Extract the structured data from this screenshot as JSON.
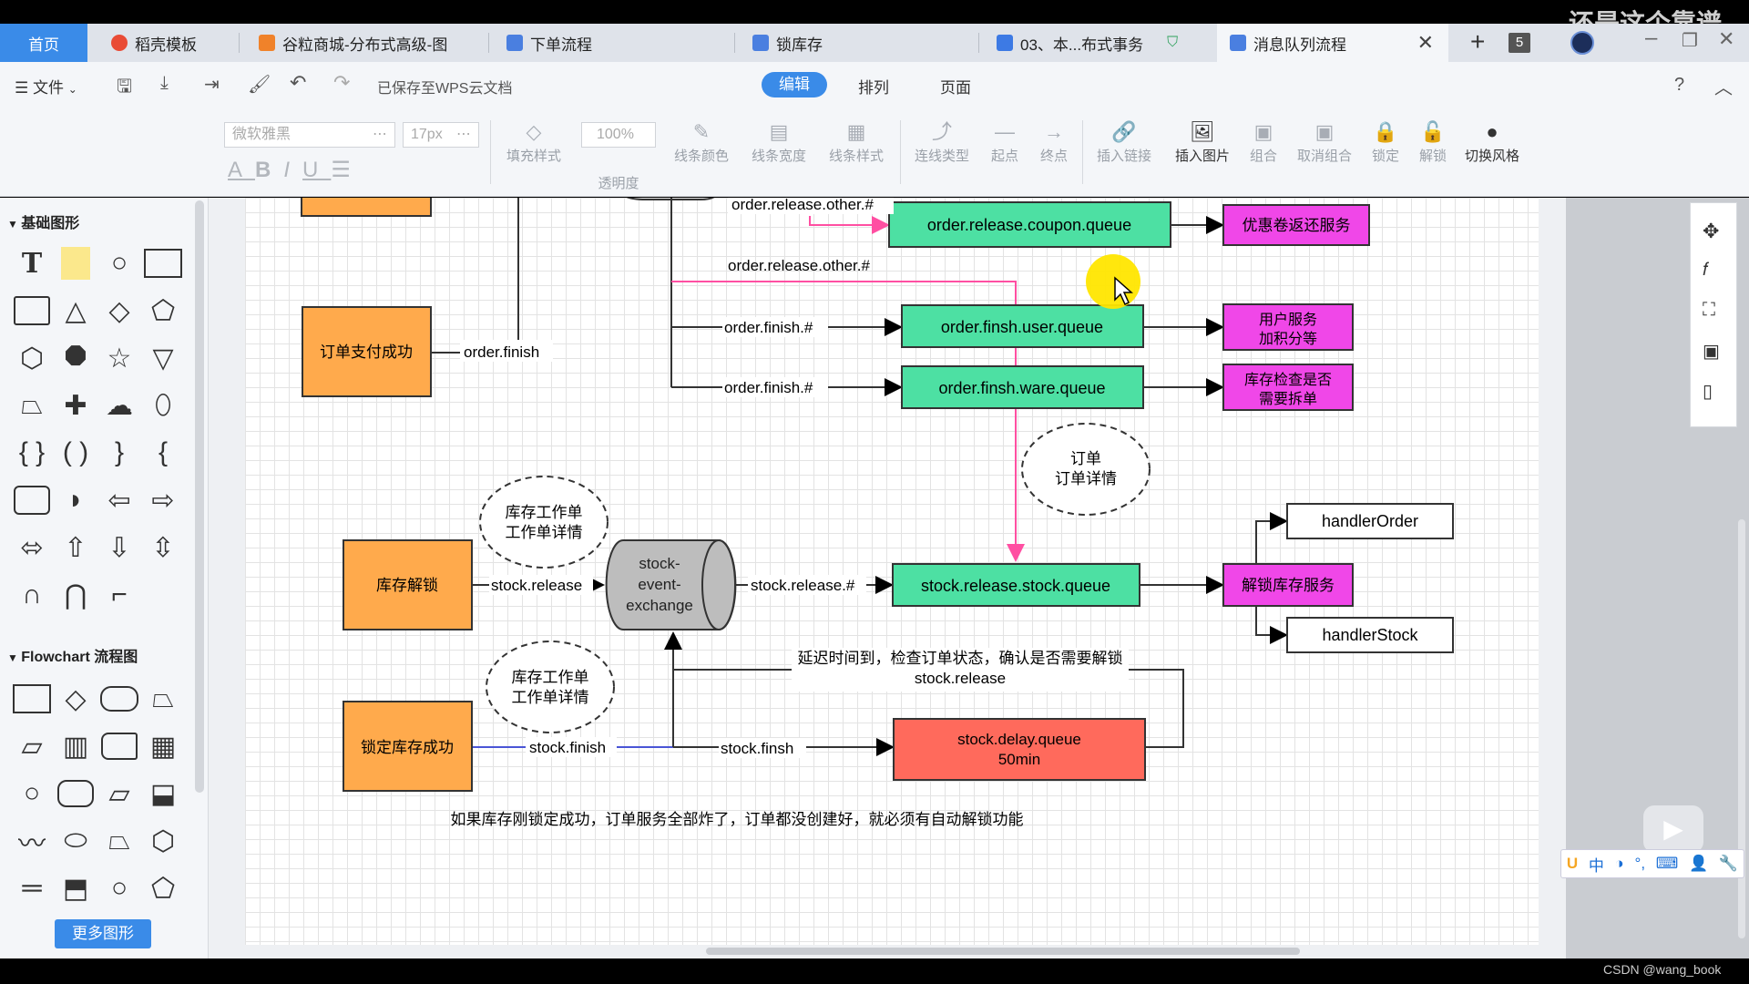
{
  "watermark": "还是这个靠谱",
  "credit": "CSDN @wang_book",
  "tabs": [
    {
      "label": "首页",
      "icon": "",
      "kind": "home"
    },
    {
      "label": "稻壳模板",
      "icon": "docer-icon",
      "color": "#e94b35"
    },
    {
      "label": "谷粒商城-分布式高级-图",
      "icon": "slides-icon",
      "color": "#f0822a"
    },
    {
      "label": "下单流程",
      "icon": "flowchart-icon",
      "color": "#4a7fe0"
    },
    {
      "label": "锁库存",
      "icon": "flowchart-icon",
      "color": "#4a7fe0"
    },
    {
      "label": "03、本...布式事务",
      "icon": "word-icon",
      "color": "#3d7ae4"
    },
    {
      "label": "消息队列流程",
      "icon": "flowchart-icon",
      "color": "#4a7fe0"
    }
  ],
  "tab_count": "5",
  "menu": {
    "file": "文件",
    "saved": "已保存至WPS云文档",
    "modes": [
      "编辑",
      "排列",
      "页面"
    ],
    "help": "?"
  },
  "ribbon": {
    "font": "微软雅黑",
    "size": "17px",
    "opacity": "100%",
    "buttons": [
      {
        "label": "填充样式",
        "glyph": "◇",
        "on": false
      },
      {
        "label": "透明度",
        "glyph": "",
        "on": false
      },
      {
        "label": "线条颜色",
        "glyph": "✎",
        "on": false
      },
      {
        "label": "线条宽度",
        "glyph": "▤",
        "on": false
      },
      {
        "label": "线条样式",
        "glyph": "▦",
        "on": false
      },
      {
        "label": "连线类型",
        "glyph": "⤴",
        "on": false
      },
      {
        "label": "起点",
        "glyph": "—",
        "on": false
      },
      {
        "label": "终点",
        "glyph": "→",
        "on": false
      },
      {
        "label": "插入链接",
        "glyph": "🔗",
        "on": false
      },
      {
        "label": "插入图片",
        "glyph": "🖼",
        "on": true
      },
      {
        "label": "组合",
        "glyph": "▣",
        "on": false
      },
      {
        "label": "取消组合",
        "glyph": "▣",
        "on": false
      },
      {
        "label": "锁定",
        "glyph": "🔒",
        "on": false
      },
      {
        "label": "解锁",
        "glyph": "🔓",
        "on": false
      },
      {
        "label": "切换风格",
        "glyph": "●",
        "on": true
      }
    ]
  },
  "left": {
    "basic": "基础图形",
    "flowchart": "Flowchart 流程图",
    "more": "更多图形"
  },
  "diagram": {
    "boxes": {
      "pay_success": "订单支付成功",
      "stock_unlock": "库存解锁",
      "lock_success": "锁定库存成功",
      "coupon_q": "order.release.coupon.queue",
      "user_q": "order.finsh.user.queue",
      "ware_q": "order.finsh.ware.queue",
      "stock_q": "stock.release.stock.queue",
      "delay_q_1": "stock.delay.queue",
      "delay_q_2": "50min",
      "coupon_svc": "优惠卷返还服务",
      "user_svc_1": "用户服务",
      "user_svc_2": "加积分等",
      "ware_svc_1": "库存检查是否",
      "ware_svc_2": "需要拆单",
      "unlock_svc": "解锁库存服务",
      "handler_order": "handlerOrder",
      "handler_stock": "handlerStock",
      "exchange_1": "stock-",
      "exchange_2": "event-",
      "exchange_3": "exchange"
    },
    "ovals": {
      "order_1": "订单",
      "order_2": "订单详情",
      "task_a_1": "库存工作单",
      "task_a_2": "工作单详情",
      "task_b_1": "库存工作单",
      "task_b_2": "工作单详情"
    },
    "labels": {
      "other_top": "order.release.other.#",
      "other": "order.release.other.#",
      "finish": "order.finish",
      "finish_hash_1": "order.finish.#",
      "finish_hash_2": "order.finish.#",
      "stock_release": "stock.release",
      "stock_release_hash": "stock.release.#",
      "stock_finish": "stock.finish",
      "stock_finsh": "stock.finsh",
      "delay_note_1": "延迟时间到，检查订单状态，确认是否需要解锁",
      "delay_note_2": "stock.release",
      "footer_note": "如果库存刚锁定成功，订单服务全部炸了，订单都没创建好，就必须有自动解锁功能"
    }
  },
  "ime": [
    "中",
    "◑",
    "°,",
    "⌨",
    "👤",
    "🔧"
  ]
}
